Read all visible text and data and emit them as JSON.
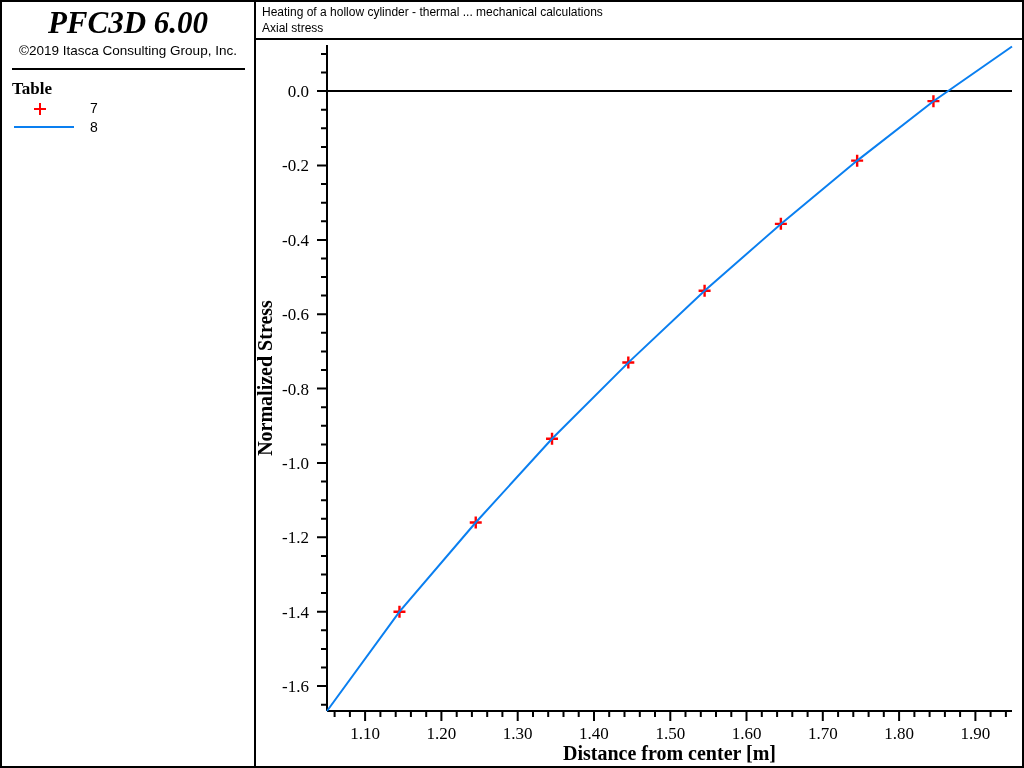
{
  "product": {
    "title": "PFC3D 6.00",
    "copyright": "©2019 Itasca Consulting Group, Inc."
  },
  "legend": {
    "title": "Table"
  },
  "plot": {
    "title": "Heating of a hollow cylinder - thermal ... mechanical calculations",
    "subtitle": "Axial stress",
    "chart_data": {
      "type": "line",
      "xlabel": "Distance from center [m]",
      "ylabel": "Normalized Stress",
      "x": [
        1.05,
        1.145,
        1.245,
        1.345,
        1.445,
        1.545,
        1.645,
        1.745,
        1.845,
        1.948
      ],
      "series": [
        {
          "name": "7",
          "type": "scatter",
          "color": "#ff0000",
          "marker": "plus",
          "values": [
            null,
            -1.4,
            -1.16,
            -0.935,
            -0.73,
            -0.537,
            -0.357,
            -0.187,
            -0.027,
            null
          ]
        },
        {
          "name": "8",
          "type": "line",
          "color": "#0a7ff0",
          "values": [
            -1.667,
            -1.4,
            -1.16,
            -0.935,
            -0.73,
            -0.537,
            -0.357,
            -0.187,
            -0.027,
            0.12
          ]
        }
      ],
      "xlim": [
        1.05,
        1.948
      ],
      "ylim": [
        -1.667,
        0.124
      ],
      "xticks": [
        {
          "value": 1.1,
          "label": "1.10"
        },
        {
          "value": 1.2,
          "label": "1.20"
        },
        {
          "value": 1.3,
          "label": "1.30"
        },
        {
          "value": 1.4,
          "label": "1.40"
        },
        {
          "value": 1.5,
          "label": "1.50"
        },
        {
          "value": 1.6,
          "label": "1.60"
        },
        {
          "value": 1.7,
          "label": "1.70"
        },
        {
          "value": 1.8,
          "label": "1.80"
        },
        {
          "value": 1.9,
          "label": "1.90"
        }
      ],
      "yticks": [
        {
          "value": 0,
          "label": "0.0"
        },
        {
          "value": -0.2,
          "label": "-0.2"
        },
        {
          "value": -0.4,
          "label": "-0.4"
        },
        {
          "value": -0.6,
          "label": "-0.6"
        },
        {
          "value": -0.8,
          "label": "-0.8"
        },
        {
          "value": -1.0,
          "label": "-1.0"
        },
        {
          "value": -1.2,
          "label": "-1.2"
        },
        {
          "value": -1.4,
          "label": "-1.4"
        },
        {
          "value": -1.6,
          "label": "-1.6"
        }
      ]
    }
  }
}
